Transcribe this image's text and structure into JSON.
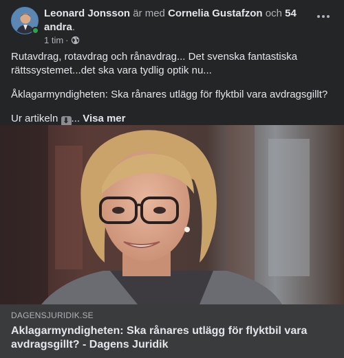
{
  "post": {
    "author": "Leonard Jonsson",
    "with_text": "är med",
    "tagged_person": "Cornelia Gustafzon",
    "and_text": "och",
    "others": "54 andra",
    "period": ".",
    "time": "1 tim",
    "time_separator": "·",
    "paragraph1": "Rutavdrag, rotavdrag och rånavdrag... Det svenska fantastiska rättssystemet...det ska vara tydlig optik nu...",
    "paragraph2": "Åklagarmyndigheten: Ska rånares utlägg för flyktbil vara avdragsgillt?",
    "paragraph3_prefix": "Ur artikeln",
    "paragraph3_ellipsis": "...",
    "see_more": "Visa mer"
  },
  "link_preview": {
    "domain": "DAGENSJURIDIK.SE",
    "title": "Aklagarmyndigheten: Ska rånares utlägg för flyktbil vara avdragsgillt? - Dagens Juridik"
  },
  "icons": {
    "privacy": "globe-icon",
    "more": "more-dots-icon",
    "inline": "down-arrow-icon"
  },
  "colors": {
    "background": "#242526",
    "link_box": "#3a3b3c",
    "text_primary": "#e4e6eb",
    "text_secondary": "#b0b3b8",
    "online": "#31a24c"
  }
}
